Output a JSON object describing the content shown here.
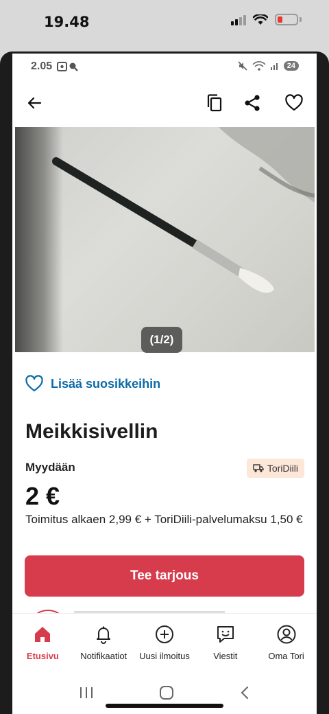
{
  "outer_status": {
    "time": "19.48"
  },
  "inner_status": {
    "time": "2.05",
    "notifications": "24"
  },
  "gallery": {
    "counter": "(1/2)"
  },
  "favorite": {
    "label": "Lisää suosikkeihin"
  },
  "listing": {
    "title": "Meikkisivellin",
    "type": "Myydään",
    "badge": "ToriDiili",
    "price": "2 €",
    "delivery": "Toimitus alkaen 2,99 € + ToriDiili-palvelumaksu 1,50 €"
  },
  "actions": {
    "offer": "Tee tarjous"
  },
  "bottom_nav": [
    {
      "label": "Etusivu",
      "icon": "home-icon",
      "active": true
    },
    {
      "label": "Notifikaatiot",
      "icon": "bell-icon"
    },
    {
      "label": "Uusi ilmoitus",
      "icon": "plus-circle-icon"
    },
    {
      "label": "Viestit",
      "icon": "chat-icon"
    },
    {
      "label": "Oma Tori",
      "icon": "profile-icon"
    }
  ],
  "colors": {
    "accent": "#d73c4c",
    "link": "#0a6aa8",
    "badge_bg": "#fde7d9"
  }
}
